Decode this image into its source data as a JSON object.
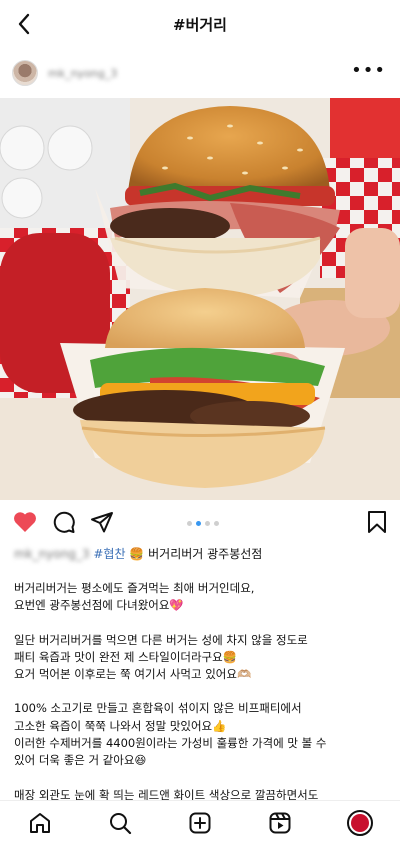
{
  "header": {
    "title": "#버거리"
  },
  "post": {
    "username": "mk_nyong_3",
    "carousel": {
      "total": 4,
      "active": 1
    },
    "caption_head": {
      "username": "mk_nyong_3",
      "tag": "#협찬",
      "emoji": "🍔",
      "text": "버거리버거 광주봉선점"
    },
    "caption_lines": [
      "버거리버거는 평소에도 즐겨먹는 최애 버거인데요,",
      "요번엔 광주봉선점에 다녀왔어요💖",
      "",
      "일단 버거리버거를 먹으면 다른 버거는 성에 차지 않을 정도로",
      "패티 육즙과 맛이 완전 제 스타일이더라구요🍔",
      "요거 먹어본 이후로는 쭉 여기서 사먹고 있어요🫶🏼",
      "",
      "100% 소고기로 만들고 혼합육이 섞이지 않은 비프패티에서",
      "고소한 육즙이 쭉쭉 나와서 정말 맛있어요👍",
      "이러한 수제버거를 4400원이라는 가성비 훌륭한 가격에 맛 볼 수",
      "있어 더욱 좋은 거 같아요😆",
      "",
      "매장 외관도 눈에 확 띄는 레드앤 화이트 색상으로 깔끔하면서도"
    ]
  },
  "colors": {
    "like": "#ed4956",
    "hashtag": "#3b6fb6",
    "accent_dot": "#3897f0"
  },
  "icons": {
    "back": "chevron-left-icon",
    "more": "more-horizontal-icon",
    "like": "heart-filled-icon",
    "comment": "comment-icon",
    "share": "send-icon",
    "save": "bookmark-icon",
    "nav": [
      "home-icon",
      "search-icon",
      "create-icon",
      "reels-icon",
      "profile-icon"
    ]
  }
}
